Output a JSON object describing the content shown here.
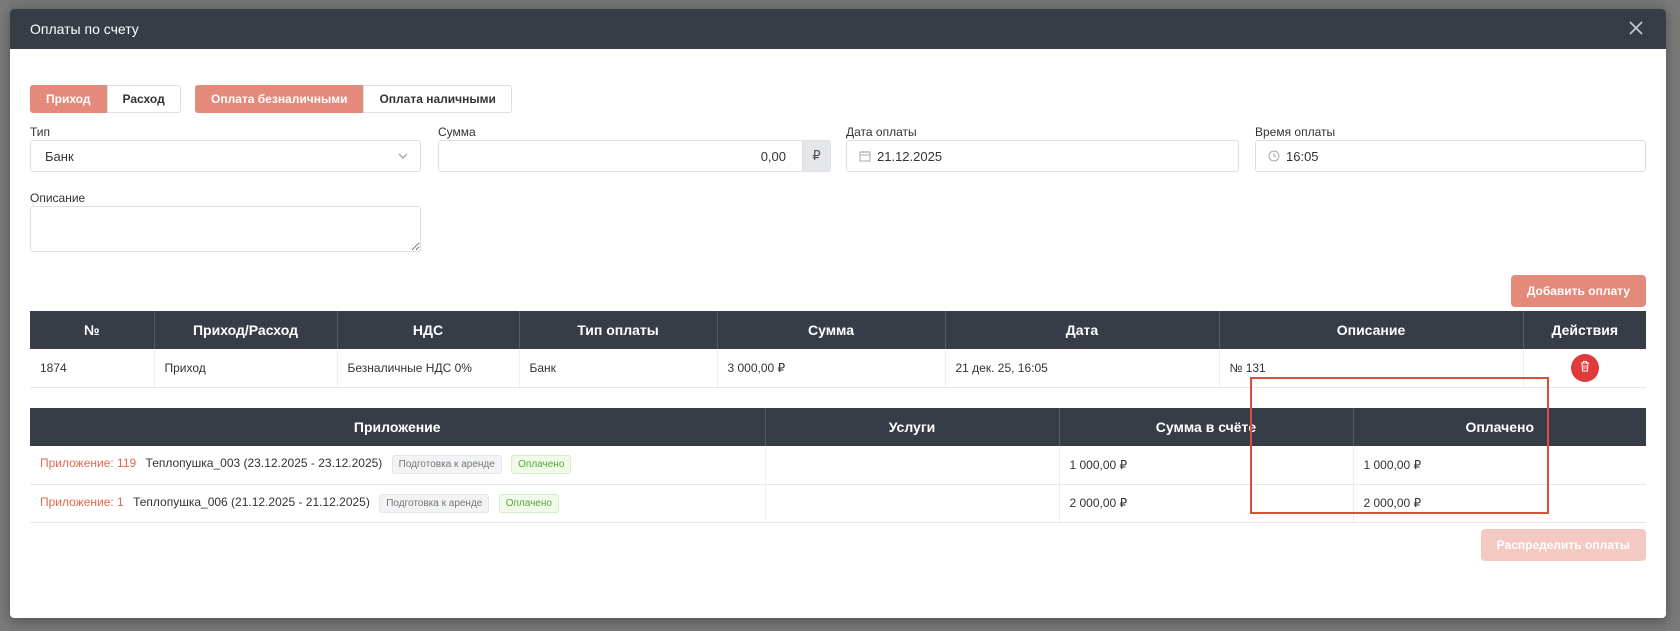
{
  "modal": {
    "title": "Оплаты по счету"
  },
  "direction_toggle": {
    "income": "Приход",
    "expense": "Расход"
  },
  "payment_method_toggle": {
    "cashless": "Оплата безналичными",
    "cash": "Оплата наличными"
  },
  "form": {
    "type_label": "Тип",
    "type_value": "Банк",
    "amount_label": "Сумма",
    "amount_value": "0,00",
    "currency_symbol": "₽",
    "date_label": "Дата оплаты",
    "date_value": "21.12.2025",
    "time_label": "Время оплаты",
    "time_value": "16:05",
    "description_label": "Описание",
    "description_value": ""
  },
  "add_payment_button": "Добавить оплату",
  "payments_table": {
    "headers": [
      "№",
      "Приход/Расход",
      "НДС",
      "Тип оплаты",
      "Сумма",
      "Дата",
      "Описание",
      "Действия"
    ],
    "rows": [
      {
        "number": "1874",
        "direction": "Приход",
        "vat": "Безналичные НДС 0%",
        "payment_type": "Банк",
        "amount": "3 000,00 ₽",
        "date": "21 дек. 25, 16:05",
        "description": "№ 131"
      }
    ]
  },
  "applications_table": {
    "headers": [
      "Приложение",
      "Услуги",
      "Сумма в счёте",
      "Оплачено"
    ],
    "rows": [
      {
        "link": "Приложение: 119",
        "name": "Теплопушка_003 (23.12.2025 - 23.12.2025)",
        "status_tag": "Подготовка к аренде",
        "paid_tag": "Оплачено",
        "services": "",
        "invoice_amount": "1 000,00 ₽",
        "paid": "1 000,00 ₽"
      },
      {
        "link": "Приложение: 1",
        "name": "Теплопушка_006 (21.12.2025 - 21.12.2025)",
        "status_tag": "Подготовка к аренде",
        "paid_tag": "Оплачено",
        "services": "",
        "invoice_amount": "2 000,00 ₽",
        "paid": "2 000,00 ₽"
      }
    ]
  },
  "distribute_button": "Распределить оплаты",
  "colors": {
    "accent": "#e48a7b",
    "header_dark": "#373d47",
    "delete_red": "#e03b3b",
    "highlight_red": "#e14b3c"
  }
}
